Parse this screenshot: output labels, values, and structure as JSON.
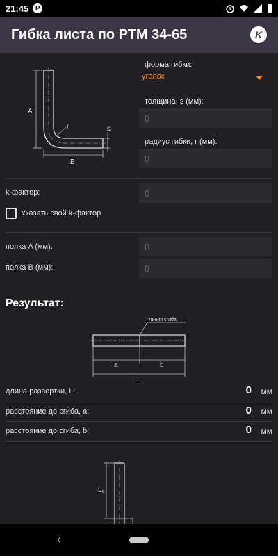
{
  "status": {
    "time": "21:45",
    "app_icon_letter": "P"
  },
  "app_bar": {
    "title": "Гибка листа по РТМ 34-65",
    "logo_letter": "K"
  },
  "diagram_top": {
    "label_a": "A",
    "label_b": "B",
    "label_r": "r",
    "label_s": "s"
  },
  "form": {
    "shape_label": "форма гибки:",
    "shape_value": "уголок",
    "thickness_label": "толщина, s (мм):",
    "thickness_placeholder": "0",
    "radius_label": "радиус гибки, r (мм):",
    "radius_placeholder": "0",
    "kfactor_label": "k-фактор:",
    "kfactor_placeholder": "0",
    "custom_k_label": "Указать свой k-фактор",
    "shelf_a_label": "полка A (мм):",
    "shelf_a_placeholder": "0",
    "shelf_b_label": "полка B (мм):",
    "shelf_b_placeholder": "0"
  },
  "result": {
    "title": "Результат:",
    "diagram": {
      "bend_line": "Линия сгиба",
      "label_a": "a",
      "label_b": "b",
      "label_l": "L"
    },
    "rows": [
      {
        "label": "длина развертки, L:",
        "value": "0",
        "unit": "мм"
      },
      {
        "label": "расстояние до сгиба, а:",
        "value": "0",
        "unit": "мм"
      },
      {
        "label": "расстояние до сгиба, b:",
        "value": "0",
        "unit": "мм"
      }
    ],
    "bottom_diagram": {
      "label_la": "Lₐ"
    }
  },
  "colors": {
    "accent": "#f08a2c",
    "app_bar": "#3c3545",
    "background": "#221f24"
  }
}
